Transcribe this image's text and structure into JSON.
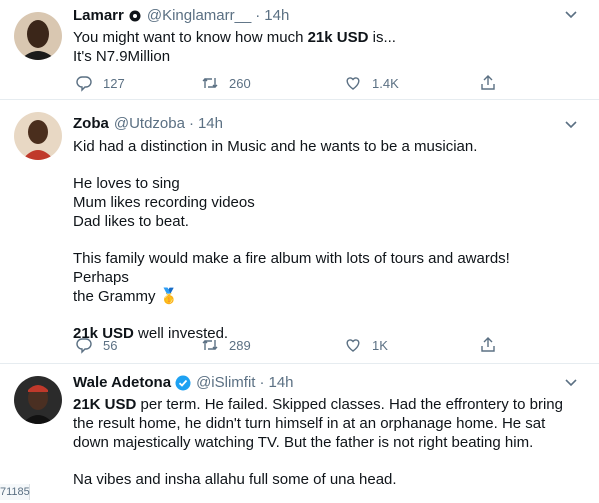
{
  "tweets": [
    {
      "name": "Lamarr",
      "verified_badge": "gear-badge-icon",
      "handle": "@Kinglamarr__",
      "separator": "·",
      "time": "14h",
      "lines": [
        {
          "pre": "You might want to know how much ",
          "bold": "21k USD",
          "post": " is..."
        },
        {
          "pre": "It's N7.9Million",
          "bold": "",
          "post": ""
        }
      ],
      "actions": {
        "replies": "127",
        "retweets": "260",
        "likes": "1.4K"
      }
    },
    {
      "name": "Zoba",
      "handle": "@Utdzoba",
      "separator": "·",
      "time": "14h",
      "para1": "Kid had a distinction in Music and he wants to be a musician.",
      "para2_lines": [
        "He loves to sing",
        "Mum likes recording videos",
        "Dad likes to beat."
      ],
      "para3_lines": [
        "This family would make a fire album with lots of tours and awards! Perhaps",
        "the Grammy"
      ],
      "emoji": "🥇",
      "para4_bold": "21k USD",
      "para4_rest": " well invested.",
      "actions": {
        "replies": "56",
        "retweets": "289",
        "likes": "1K"
      }
    },
    {
      "name": "Wale Adetona",
      "verified_badge": "blue-check-icon",
      "handle": "@iSlimfit",
      "separator": "·",
      "time": "14h",
      "line1_bold": "21K USD",
      "line1_rest": " per term. He failed. Skipped classes. Had the effrontery to bring",
      "lines": [
        "the result home, he didn't turn himself in at an orphanage home. He sat",
        "down majestically watching TV. But the father is not right beating him."
      ],
      "para2": "Na vibes and insha allahu full some of una head."
    }
  ],
  "edge_number": "71185",
  "colors": {
    "muted": "#5b7083",
    "verified": "#1da1f2",
    "divider": "#e6ecf0"
  }
}
